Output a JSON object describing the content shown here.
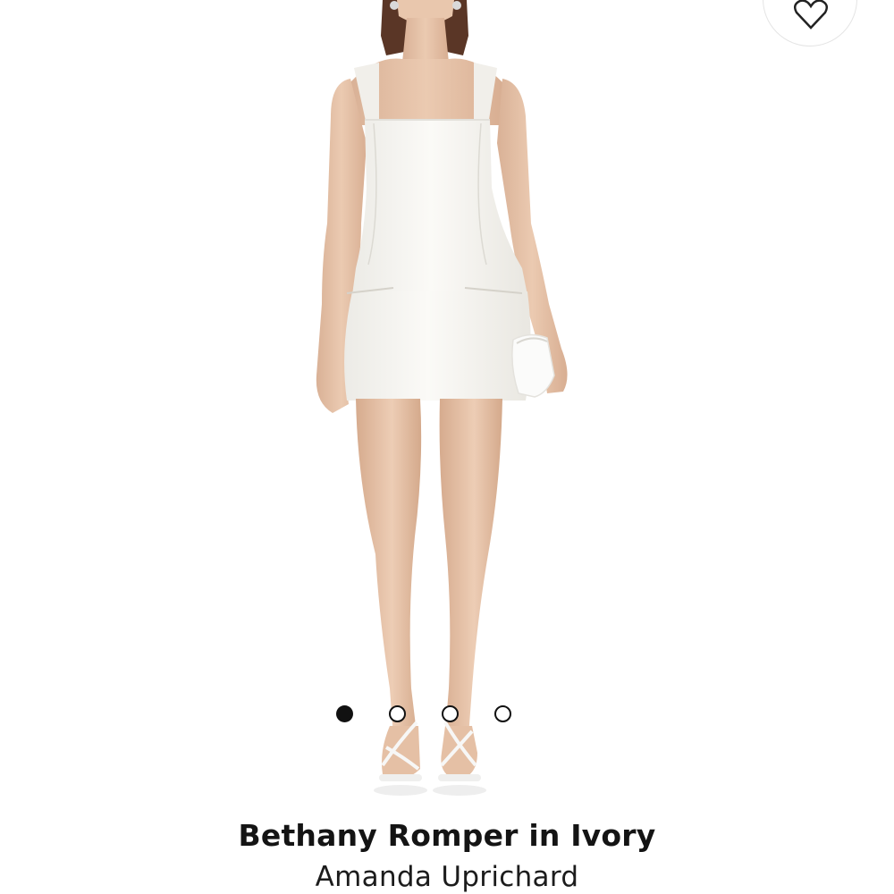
{
  "product": {
    "title": "Bethany Romper in Ivory",
    "brand": "Amanda Uprichard",
    "image_alt": "Model wearing ivory square-neck romper with white strappy sandals and white clutch"
  },
  "wishlist": {
    "icon": "heart-icon"
  },
  "carousel": {
    "total": 4,
    "active_index": 0
  },
  "colors": {
    "garment": "#f5f3ee",
    "skin": "#e6c3a8",
    "hair": "#5a3626",
    "background": "#ffffff",
    "text": "#141414"
  }
}
